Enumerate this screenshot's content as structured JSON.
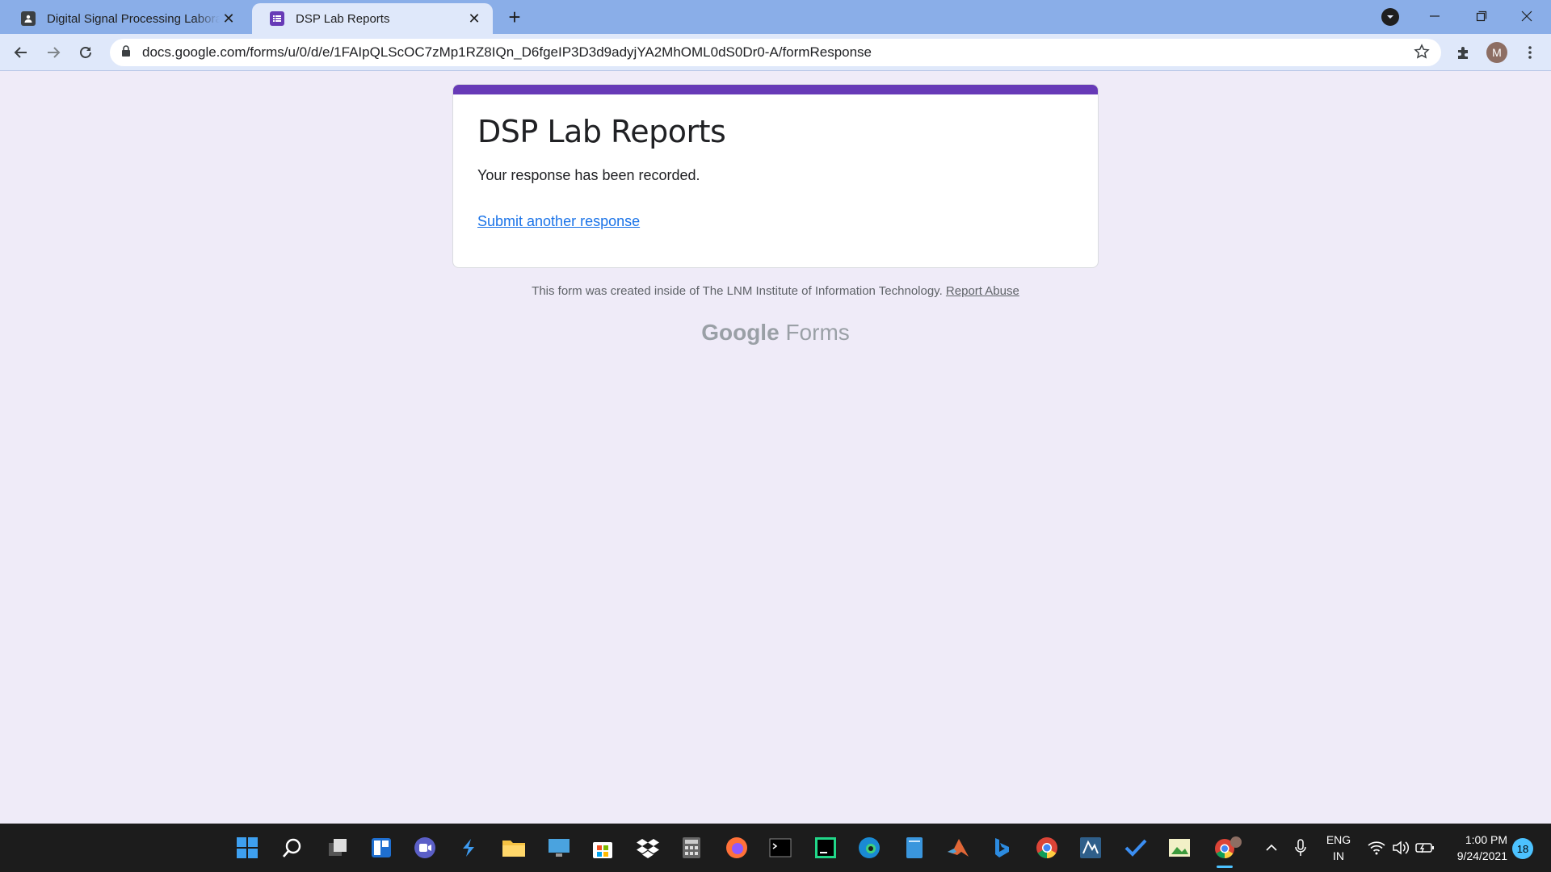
{
  "browser": {
    "tabs": [
      {
        "title": "Digital Signal Processing Laborat",
        "icon": "classroom-icon",
        "active": false
      },
      {
        "title": "DSP Lab Reports",
        "icon": "forms-icon",
        "active": true
      }
    ],
    "url": "docs.google.com/forms/u/0/d/e/1FAIpQLScOC7zMp1RZ8IQn_D6fgeIP3D3d9adyjYA2MhOML0dS0Dr0-A/formResponse",
    "profile_initial": "M"
  },
  "form": {
    "title": "DSP Lab Reports",
    "confirmation": "Your response has been recorded.",
    "submit_another": "Submit another response",
    "footer_note": "This form was created inside of The LNM Institute of Information Technology.",
    "report_abuse": "Report Abuse",
    "brand_google": "Google",
    "brand_forms": "Forms",
    "accent_color": "#673ab7"
  },
  "taskbar": {
    "language": "ENG",
    "region": "IN",
    "time": "1:00 PM",
    "date": "9/24/2021",
    "notification_count": "18"
  }
}
